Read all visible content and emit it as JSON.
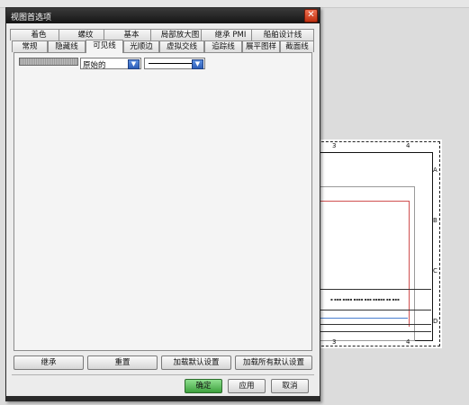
{
  "dialog": {
    "title": "视图首选项",
    "close_glyph": "✕",
    "tabs_back": [
      "着色",
      "螺纹",
      "基本",
      "局部放大图",
      "继承 PMI",
      "船舶设计线"
    ],
    "tabs_front": [
      "常规",
      "隐藏线",
      "可见线",
      "光顺边",
      "虚拟交线",
      "追踪线",
      "展平图样",
      "截面线"
    ],
    "active_tab": "可见线",
    "panel": {
      "color_select": "原始的",
      "line_select": ""
    },
    "buttons": {
      "inherit": "继承",
      "reset": "重置",
      "load_default": "加载默认设置",
      "load_all_default": "加载所有默认设置",
      "ok": "确定",
      "apply": "应用",
      "cancel": "取消"
    }
  },
  "drawing": {
    "zone_numbers_top": [
      "3",
      "4"
    ],
    "zone_numbers_bottom": [
      "3",
      "4"
    ],
    "zone_letters": [
      "A",
      "B",
      "C",
      "D"
    ]
  }
}
